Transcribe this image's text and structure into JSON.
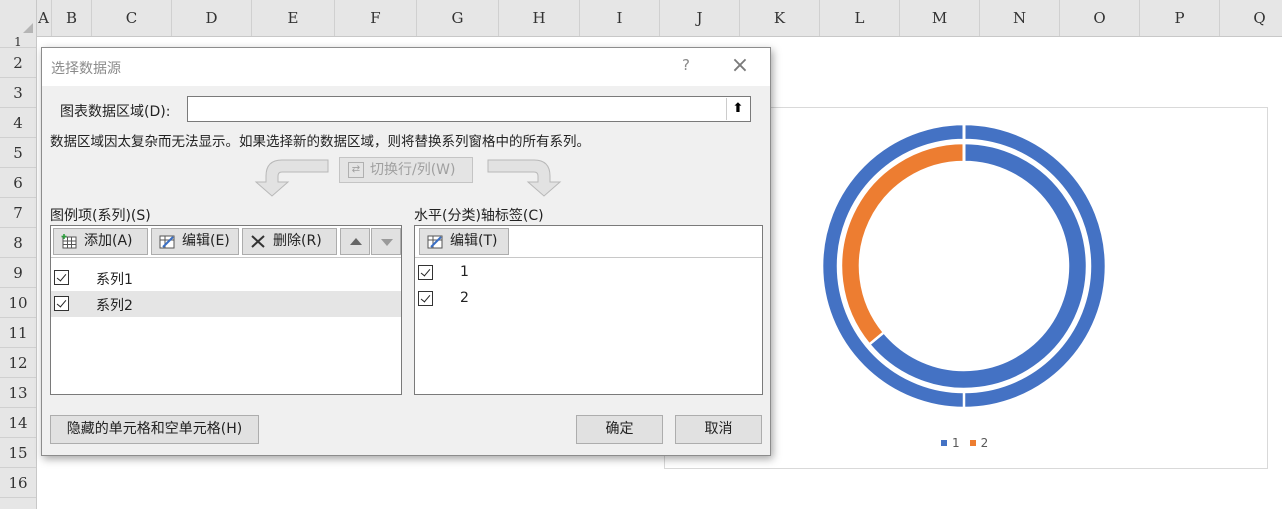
{
  "sheet": {
    "columns": [
      "A",
      "B",
      "C",
      "D",
      "E",
      "F",
      "G",
      "H",
      "I",
      "J",
      "K",
      "L",
      "M",
      "N",
      "O",
      "P",
      "Q"
    ],
    "rows": [
      "1",
      "2",
      "3",
      "4",
      "5",
      "6",
      "7",
      "8",
      "9",
      "10",
      "11",
      "12",
      "13",
      "14",
      "15",
      "16"
    ]
  },
  "dialog": {
    "title": "选择数据源",
    "help": "?",
    "close": "×",
    "range_label": "图表数据区域(D):",
    "range_value": "",
    "message": "数据区域因太复杂而无法显示。如果选择新的数据区域，则将替换系列窗格中的所有系列。",
    "switch_button": "切换行/列(W)",
    "legend_header": "图例项(系列)(S)",
    "add_button": "添加(A)",
    "edit_button": "编辑(E)",
    "delete_button": "删除(R)",
    "series": [
      {
        "label": "系列1",
        "checked": true
      },
      {
        "label": "系列2",
        "checked": true
      }
    ],
    "axis_header": "水平(分类)轴标签(C)",
    "axis_edit_button": "编辑(T)",
    "categories": [
      {
        "label": "1",
        "checked": true
      },
      {
        "label": "2",
        "checked": true
      }
    ],
    "hidden_cells_button": "隐藏的单元格和空单元格(H)",
    "ok_button": "确定",
    "cancel_button": "取消"
  },
  "chart_data": {
    "type": "pie",
    "subtype": "doughnut",
    "categories": [
      "1",
      "2"
    ],
    "series": [
      {
        "values": [
          100,
          0
        ]
      },
      {
        "values": [
          64,
          36
        ]
      }
    ],
    "colors": {
      "1": "#4472c4",
      "2": "#ed7d31"
    },
    "legend": "bottom",
    "legend_entries": [
      "1",
      "2"
    ]
  }
}
